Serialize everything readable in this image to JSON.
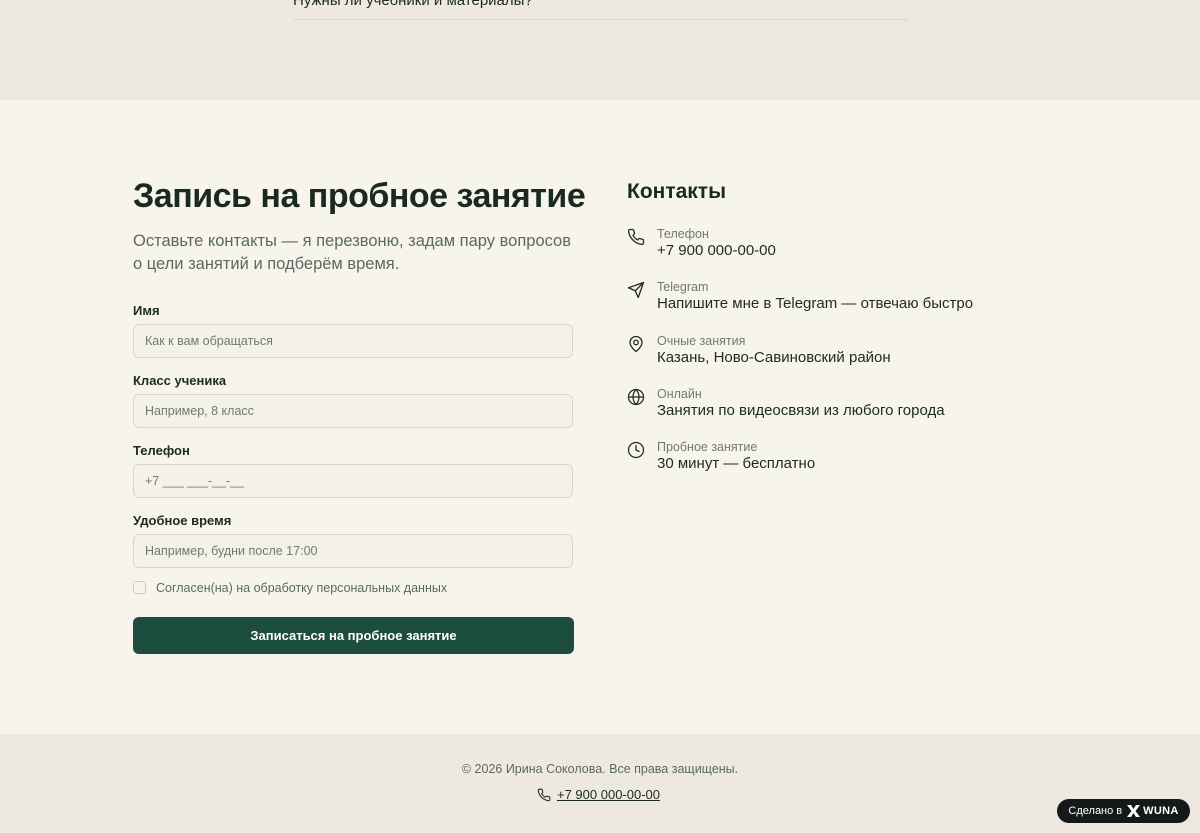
{
  "faq": {
    "partial_question": "Нужны ли учебники и материалы?"
  },
  "form": {
    "title": "Запись на пробное занятие",
    "subtitle": "Оставьте контакты — я перезвоню, задам пару вопросов о цели занятий и подберём время.",
    "fields": [
      {
        "label": "Имя",
        "placeholder": "Как к вам обращаться"
      },
      {
        "label": "Класс ученика",
        "placeholder": "Например, 8 класс"
      },
      {
        "label": "Телефон",
        "placeholder": "+7 ___ ___-__-__"
      },
      {
        "label": "Удобное время",
        "placeholder": "Например, будни после 17:00"
      }
    ],
    "consent_label": "Согласен(на) на обработку персональных данных",
    "submit_label": "Записаться на пробное занятие"
  },
  "contacts": {
    "title": "Контакты",
    "items": [
      {
        "icon": "phone-icon",
        "label": "Телефон",
        "value": "+7 900 000-00-00"
      },
      {
        "icon": "send-icon",
        "label": "Telegram",
        "value": "Напишите мне в Telegram — отвечаю быстро"
      },
      {
        "icon": "location-pin-icon",
        "label": "Очные занятия",
        "value": "Казань, Ново-Савиновский район"
      },
      {
        "icon": "globe-icon",
        "label": "Онлайн",
        "value": "Занятия по видеосвязи из любого города"
      },
      {
        "icon": "clock-icon",
        "label": "Пробное занятие",
        "value": "30 минут — бесплатно"
      }
    ]
  },
  "footer": {
    "copyright": "© 2026 Ирина Соколова. Все права защищены.",
    "phone": "+7 900 000-00-00"
  },
  "badge": {
    "prefix": "Сделано в",
    "brand": "WUNA"
  },
  "colors": {
    "accent": "#1c4d3f",
    "background": "#f7f4ec",
    "band": "#ede9e0",
    "text": "#1c2b22"
  }
}
